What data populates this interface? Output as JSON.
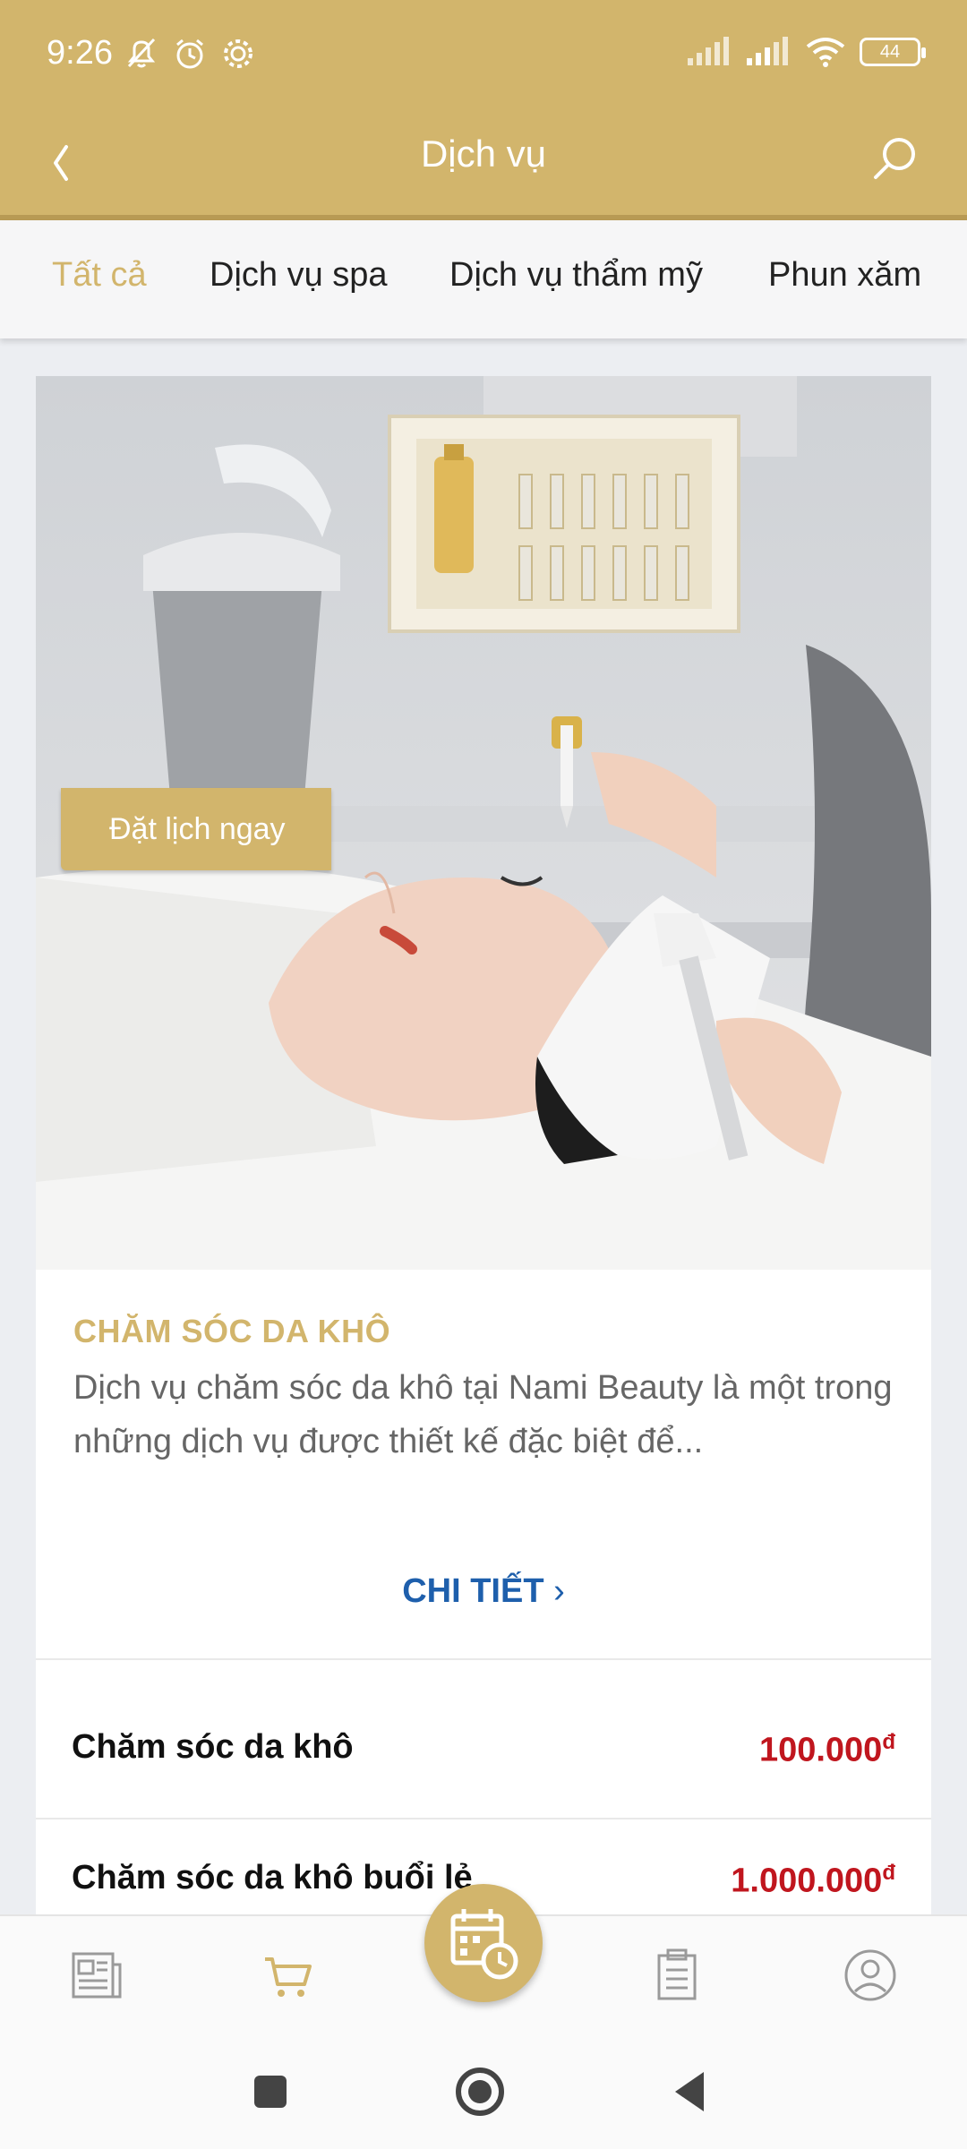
{
  "status_bar": {
    "time": "9:26",
    "battery": "44"
  },
  "header": {
    "title": "Dịch vụ"
  },
  "tabs": [
    {
      "label": "Tất cả",
      "active": true
    },
    {
      "label": "Dịch vụ spa",
      "active": false
    },
    {
      "label": "Dịch vụ thẩm mỹ",
      "active": false
    },
    {
      "label": "Phun xăm",
      "active": false
    }
  ],
  "card": {
    "badge_label": "Đặt lịch ngay",
    "title": "CHĂM SÓC DA KHÔ",
    "description": "Dịch vụ chăm sóc da khô tại Nami Beauty là một trong những dịch vụ được thiết kế đặc biệt để...",
    "detail_label": "CHI TIẾT",
    "detail_chevron": "›",
    "items": [
      {
        "name": "Chăm sóc da khô",
        "price": "100.000",
        "currency": "đ"
      },
      {
        "name": "Chăm sóc da khô buổi lẻ",
        "price": "1.000.000",
        "currency": "đ"
      }
    ]
  },
  "bottom_nav": {
    "items": [
      {
        "icon": "news-icon",
        "active": false
      },
      {
        "icon": "cart-icon",
        "active": true
      },
      {
        "icon": "calendar-clock-icon",
        "active": false
      },
      {
        "icon": "clipboard-icon",
        "active": false
      },
      {
        "icon": "user-circle-icon",
        "active": false
      }
    ]
  },
  "colors": {
    "accent": "#d2b56c",
    "price": "#c0161e",
    "link": "#1e5fac"
  }
}
